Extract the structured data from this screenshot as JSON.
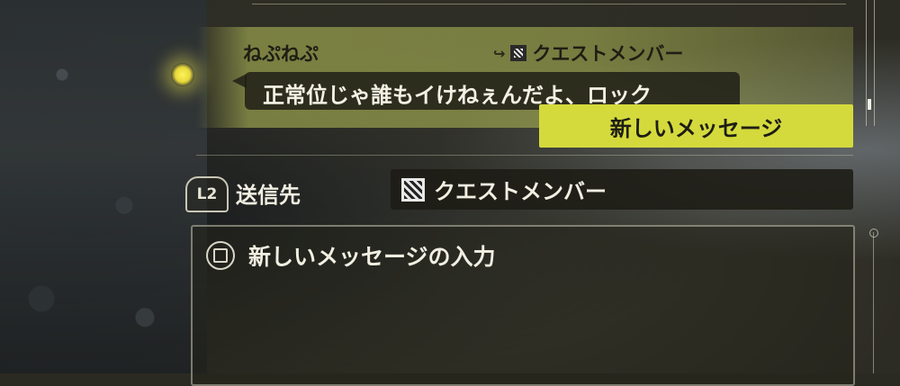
{
  "chat": {
    "sender_name": "ねぷねぷ",
    "recipient": "クエストメンバー",
    "message_text": "正常位じゃ誰もイけねぇんだよ、ロック",
    "new_message_button": "新しいメッセージ"
  },
  "send_target": {
    "button_hint": "L2",
    "label": "送信先",
    "value": "クエストメンバー",
    "icon": "party-icon"
  },
  "input": {
    "placeholder_label": "新しいメッセージの入力",
    "button_hint_icon": "square-button-icon"
  },
  "colors": {
    "accent": "#d4da3c",
    "highlight_band": "#b8c25a",
    "text_light": "#f1efe2",
    "text_dark": "#1e1e14"
  }
}
